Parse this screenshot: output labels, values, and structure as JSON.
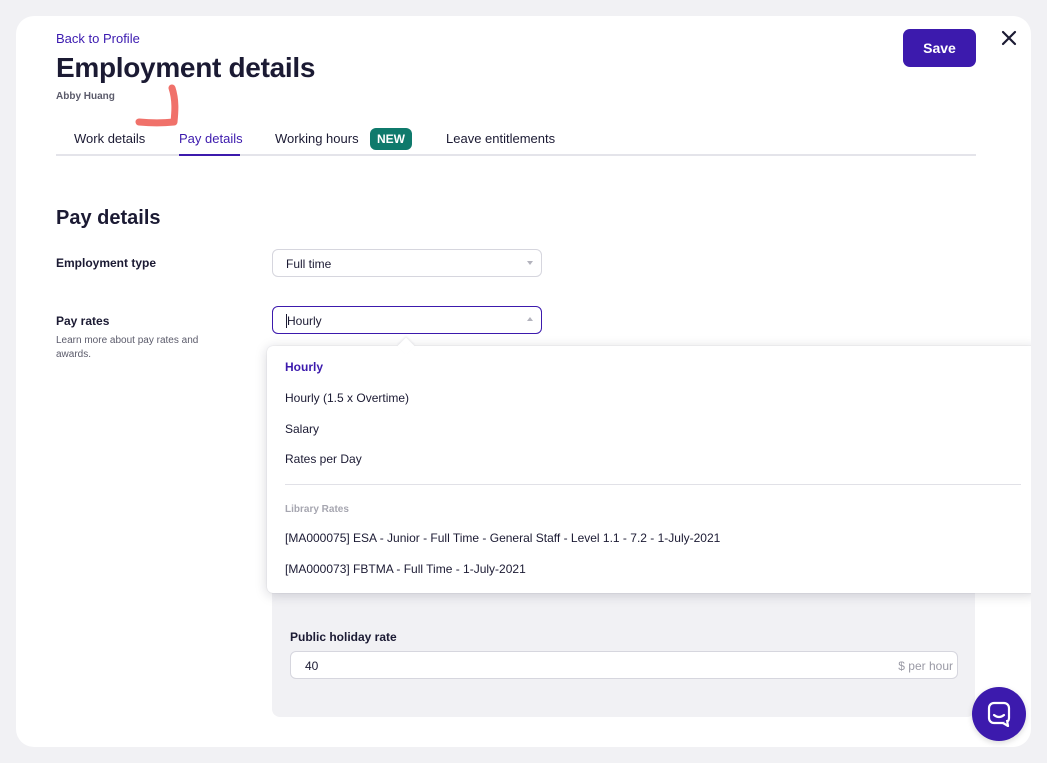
{
  "header": {
    "back_link": "Back to Profile",
    "title": "Employment details",
    "subtitle": "Abby Huang",
    "save_label": "Save"
  },
  "tabs": [
    {
      "label": "Work details",
      "active": false
    },
    {
      "label": "Pay details",
      "active": true
    },
    {
      "label": "Working hours",
      "active": false,
      "badge": "NEW"
    },
    {
      "label": "Leave entitlements",
      "active": false
    }
  ],
  "section": {
    "title": "Pay details",
    "employment_type": {
      "label": "Employment type",
      "value": "Full time"
    },
    "pay_rates": {
      "label": "Pay rates",
      "help": "Learn more about pay rates and awards.",
      "value": "Hourly"
    }
  },
  "dropdown": {
    "options": [
      {
        "label": "Hourly",
        "selected": true
      },
      {
        "label": "Hourly (1.5 x Overtime)",
        "selected": false
      },
      {
        "label": "Salary",
        "selected": false
      },
      {
        "label": "Rates per Day",
        "selected": false
      }
    ],
    "group_label": "Library Rates",
    "library_options": [
      "[MA000075] ESA - Junior - Full Time - General Staff - Level 1.1 - 7.2 - 1-July-2021",
      "[MA000073] FBTMA - Full Time - 1-July-2021"
    ]
  },
  "public_holiday": {
    "label": "Public holiday rate",
    "value": "40",
    "suffix": "$ per hour"
  },
  "colors": {
    "accent": "#3c1aad",
    "badge": "#0f7a6c",
    "marker": "#f0716a"
  },
  "icons": {
    "close": "close-icon",
    "chat": "chat-icon",
    "select_arrow": "chevron-down-icon"
  }
}
